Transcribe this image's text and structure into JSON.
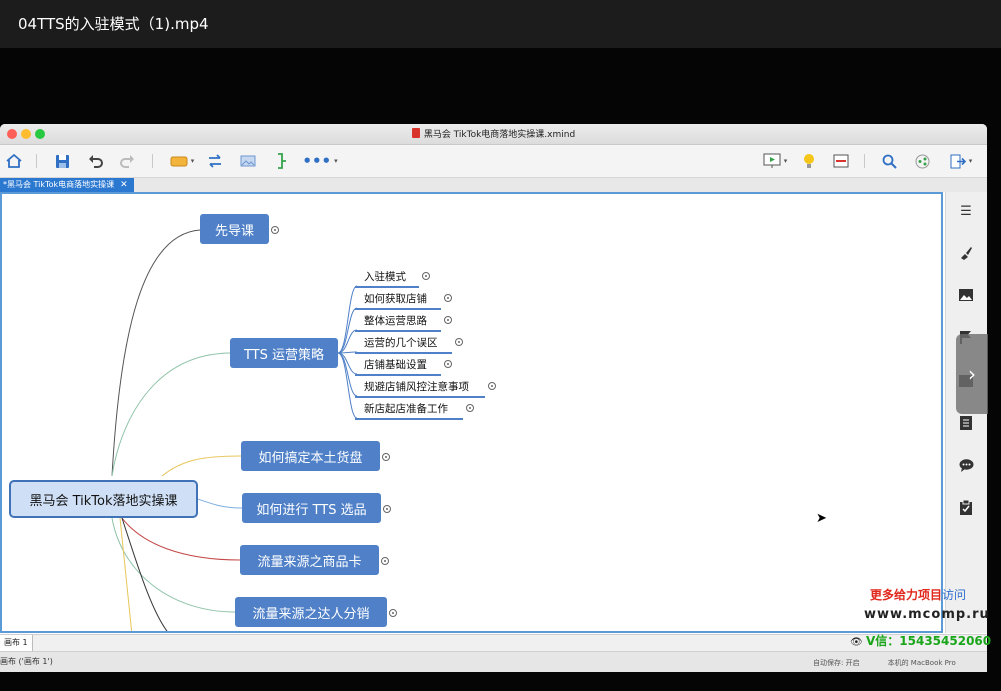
{
  "player": {
    "title": "04TTS的入驻模式（1).mp4"
  },
  "window": {
    "doc_title": "黑马会 TikTok电商落地实操课.xmind"
  },
  "toolbar": {
    "items": [
      "home-icon",
      "save-icon",
      "undo-icon",
      "redo-icon",
      "topic-icon",
      "relationship-icon",
      "image-icon",
      "boundary-icon",
      "more-icon",
      "presentation-icon",
      "idea-icon",
      "outliner-icon",
      "search-icon",
      "share-icon",
      "export-icon"
    ]
  },
  "tabs": {
    "active": "*黑马会 TikTok电商落地实操课",
    "close": "✕"
  },
  "mindmap": {
    "central": "黑马会 TikTok落地实操课",
    "topics": [
      "先导课",
      "TTS 运营策略",
      "如何搞定本土货盘",
      "如何进行 TTS 选品",
      "流量来源之商品卡",
      "流量来源之达人分销"
    ],
    "subtopics": [
      "入驻模式",
      "如何获取店铺",
      "整体运营思路",
      "运营的几个误区",
      "店铺基础设置",
      "规避店铺风控注意事项",
      "新店起店准备工作"
    ]
  },
  "sheet": {
    "tab": "画布 1",
    "status": "画布 ('画布 1')",
    "status_right": "自动保存: 开启　　　　本机的 MacBook Pro"
  },
  "watermark": {
    "promo": "更多给力项目",
    "promo_tail": "访问",
    "site": "www.mcomp.ru",
    "contact": "V信：15435452060"
  },
  "colors": {
    "accent": "#4f80c8",
    "central_fill": "#cfe0f6",
    "canvas_border": "#5a9ad6",
    "promo_red": "#e0281c",
    "contact_green": "#1aa61a"
  }
}
